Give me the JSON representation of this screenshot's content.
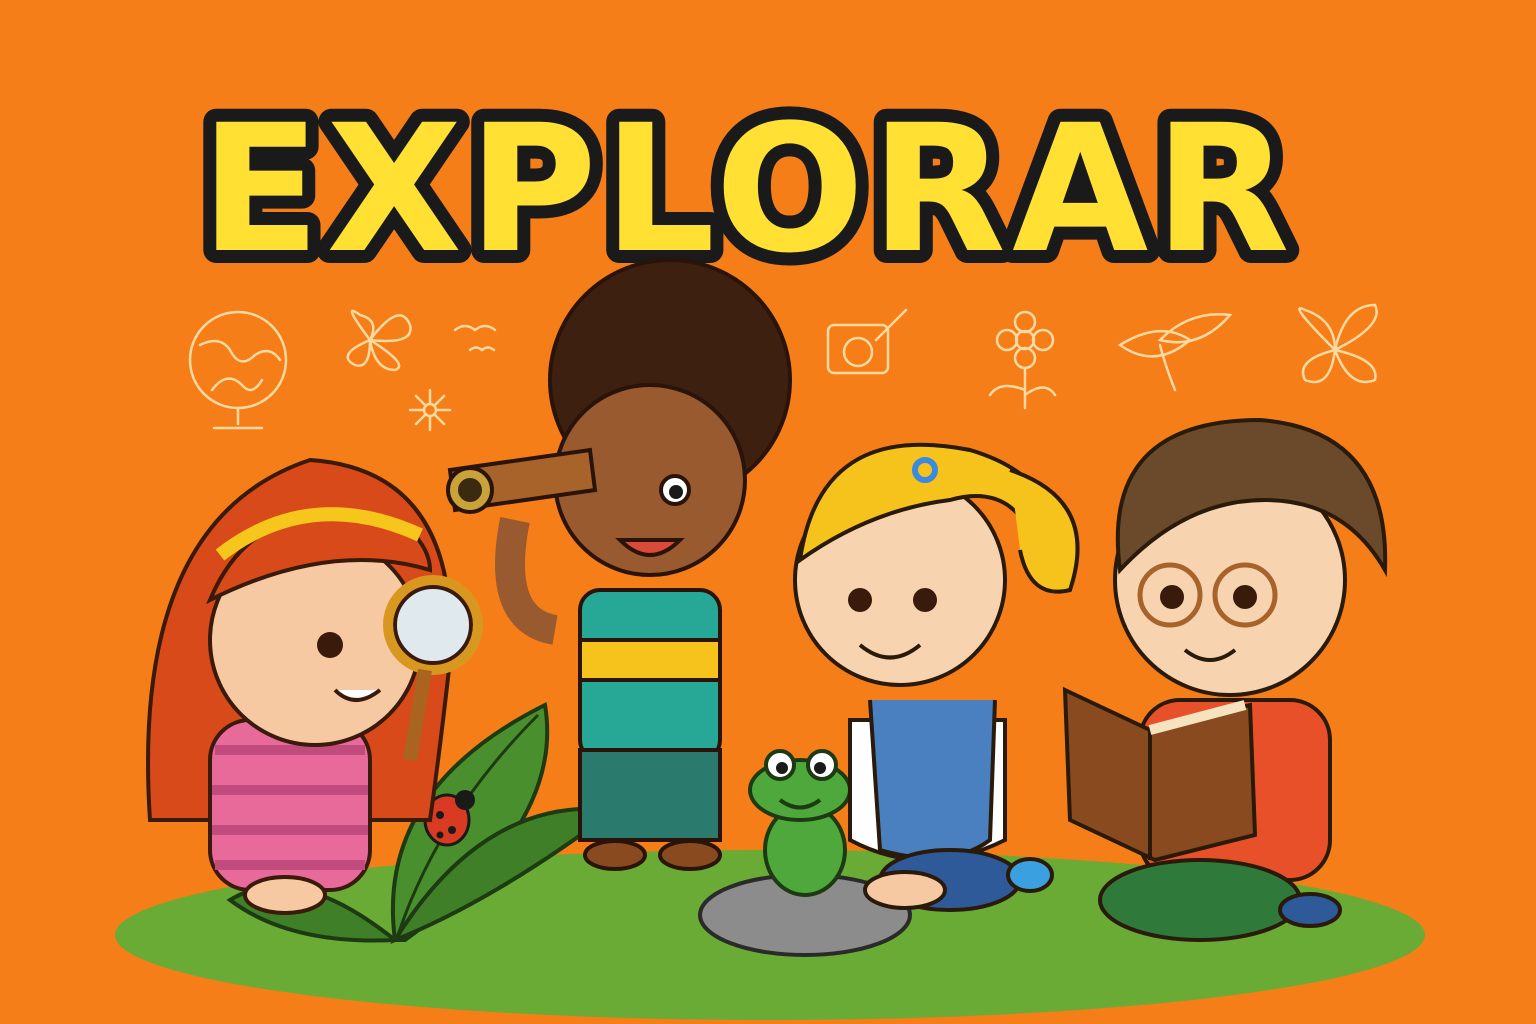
{
  "title": "EXPLORAR",
  "colors": {
    "background": "#f57e19",
    "title_fill": "#ffe033",
    "title_outline": "#1a1a1a",
    "grass": "#6aab35",
    "doodle": "#ffd9a0"
  },
  "icons": [
    "globe-icon",
    "butterfly-icon",
    "bird-icon",
    "camera-icon",
    "flower-icon",
    "leaf-icon",
    "butterfly-icon"
  ],
  "characters": [
    "girl-with-magnifier",
    "boy-with-telescope",
    "girl-with-frog",
    "boy-with-book"
  ]
}
